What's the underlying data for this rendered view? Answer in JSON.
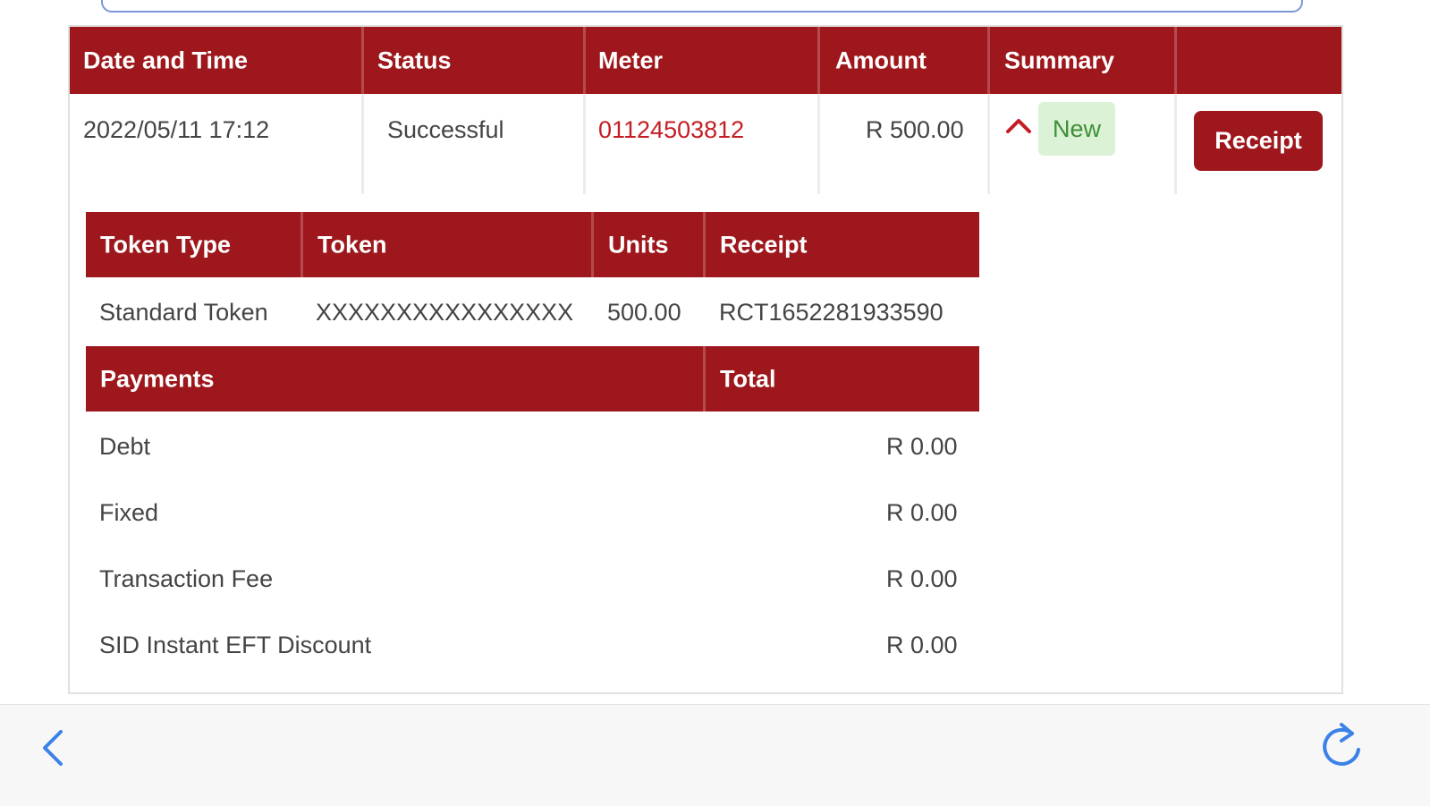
{
  "transactions_table": {
    "headers": [
      "Date and Time",
      "Status",
      "Meter",
      "Amount",
      "Summary",
      ""
    ],
    "row": {
      "date_time": "2022/05/11 17:12",
      "status": "Successful",
      "meter": "01124503812",
      "amount": "R 500.00",
      "summary_badge": "New",
      "receipt_button": "Receipt"
    }
  },
  "token_table": {
    "headers": [
      "Token Type",
      "Token",
      "Units",
      "Receipt"
    ],
    "row": {
      "token_type": "Standard Token",
      "token": "XXXXXXXXXXXXXXXX",
      "units": "500.00",
      "receipt": "RCT1652281933590"
    }
  },
  "payments_table": {
    "headers": [
      "Payments",
      "Total"
    ],
    "rows": [
      {
        "label": "Debt",
        "total": "R 0.00"
      },
      {
        "label": "Fixed",
        "total": "R 0.00"
      },
      {
        "label": "Transaction Fee",
        "total": "R 0.00"
      },
      {
        "label": "SID Instant EFT Discount",
        "total": "R 0.00"
      }
    ]
  },
  "icons": {
    "collapse": "chevron-up-icon",
    "back": "chevron-left-icon",
    "reload": "reload-icon"
  },
  "colors": {
    "header_red": "#9d171c",
    "meter_red": "#c41e24",
    "badge_bg": "#dbf2d6",
    "badge_text": "#3e8f36",
    "nav_blue": "#3b82e8"
  }
}
